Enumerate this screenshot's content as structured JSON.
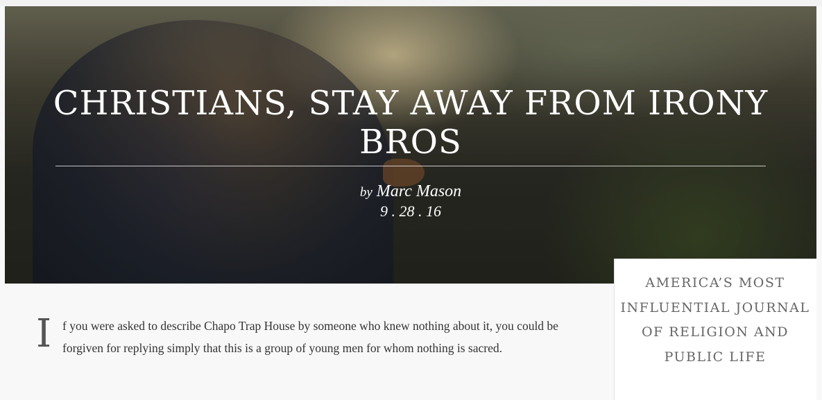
{
  "article": {
    "title": "CHRISTIANS, STAY AWAY FROM IRONY BROS",
    "byline_prefix": "by",
    "author": "Marc Mason",
    "date": "9 . 28 . 16",
    "dropcap": "I",
    "lead_text": "f you were asked to describe Chapo Trap House by someone who knew nothing about it, you could be forgiven for replying simply that this is a group of young men for whom nothing is sacred."
  },
  "sidebar": {
    "tagline": "AMERICA’S MOST INFLUENTIAL JOURNAL OF RELIGION AND PUBLIC LIFE"
  }
}
